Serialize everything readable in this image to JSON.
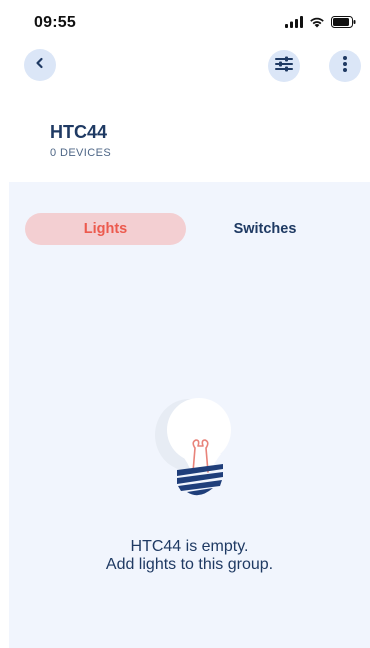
{
  "status_bar": {
    "time": "09:55",
    "icons": [
      "signal-icon",
      "wifi-icon",
      "battery-icon"
    ]
  },
  "nav": {
    "back_icon": "chevron-left-icon",
    "filter_icon": "sliders-icon",
    "more_icon": "more-vertical-icon"
  },
  "group": {
    "name": "HTC44",
    "device_count_label": "0 DEVICES"
  },
  "tabs": [
    {
      "label": "Lights",
      "active": true
    },
    {
      "label": "Switches",
      "active": false
    }
  ],
  "empty_state": {
    "icon": "light-bulb-icon",
    "line1": "HTC44 is empty.",
    "line2": "Add lights to this group."
  },
  "colors": {
    "accent": "#ec5a4e",
    "active_tab_bg": "#f3cfd2",
    "primary_text": "#1f3a63",
    "content_bg": "#f1f5fd",
    "button_bg": "#dbe6f7"
  }
}
